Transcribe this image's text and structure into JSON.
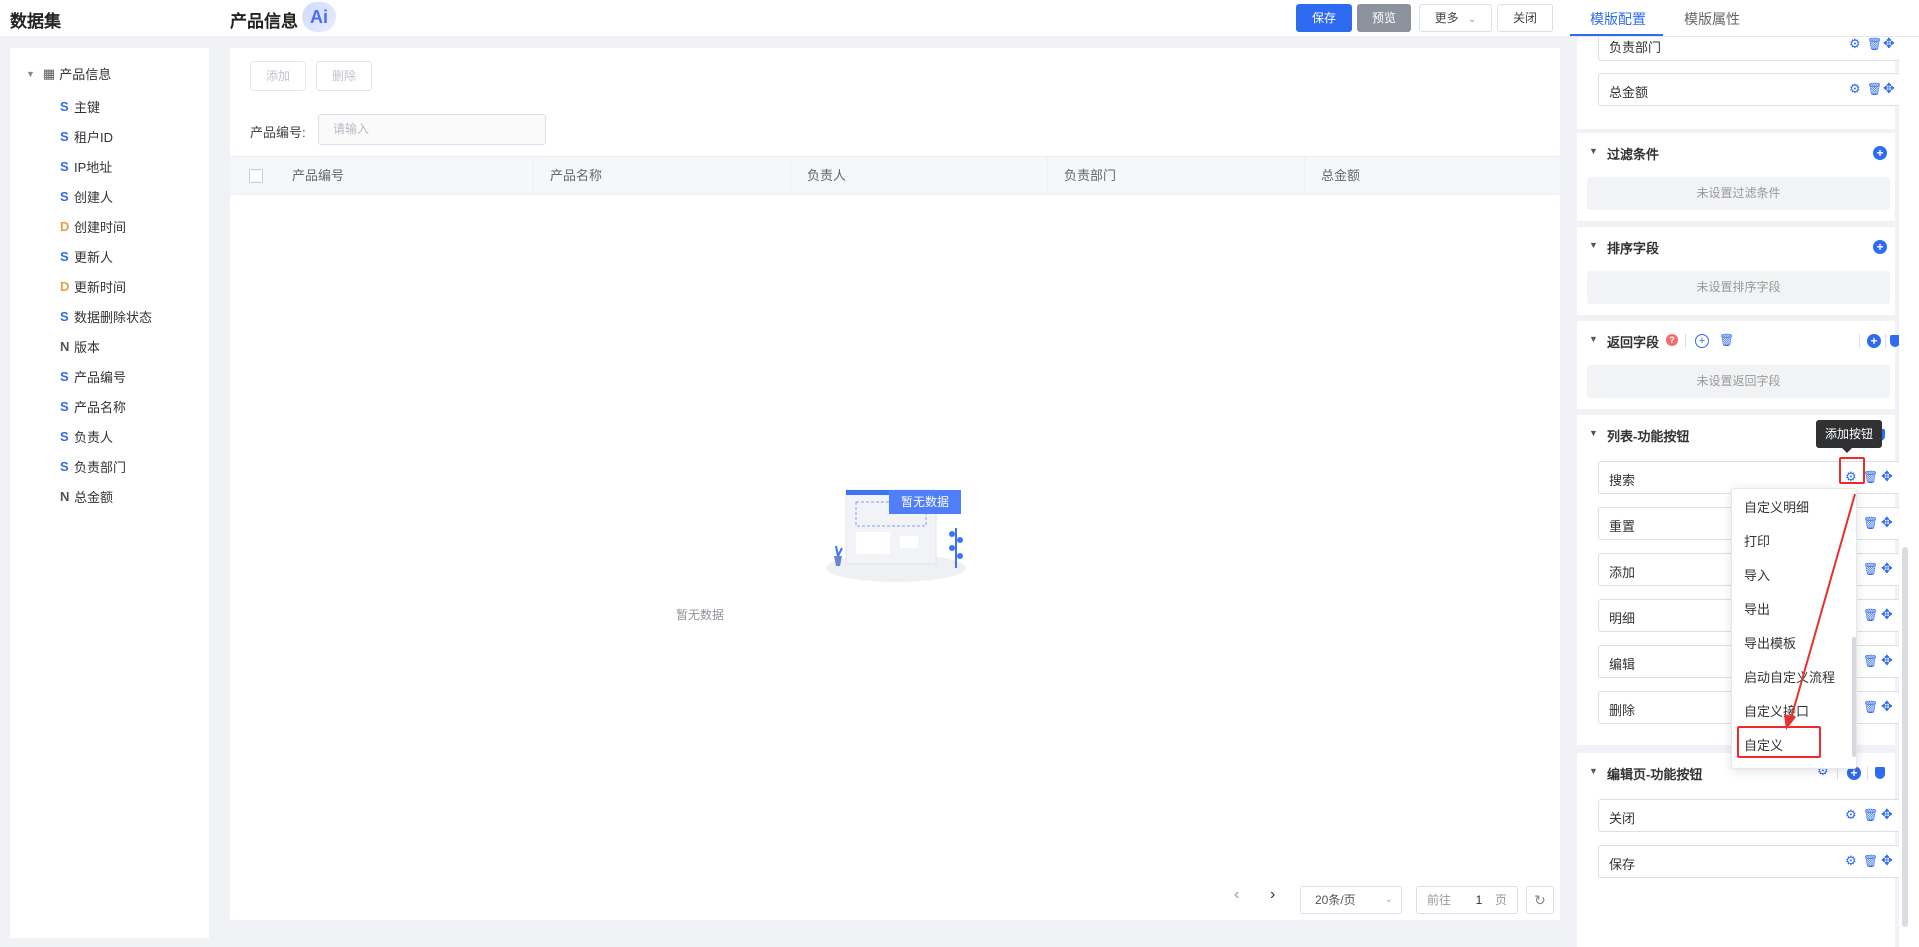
{
  "header": {
    "app_title": "数据集",
    "page_title": "产品信息",
    "ai_badge": "Ai",
    "save_label": "保存",
    "preview_label": "预览",
    "more_label": "更多",
    "close_label": "关闭"
  },
  "tree": {
    "root_label": "产品信息",
    "items": [
      {
        "type": "S",
        "label": "主键"
      },
      {
        "type": "S",
        "label": "租户ID"
      },
      {
        "type": "S",
        "label": "IP地址"
      },
      {
        "type": "S",
        "label": "创建人"
      },
      {
        "type": "D",
        "label": "创建时间"
      },
      {
        "type": "S",
        "label": "更新人"
      },
      {
        "type": "D",
        "label": "更新时间"
      },
      {
        "type": "S",
        "label": "数据删除状态"
      },
      {
        "type": "N",
        "label": "版本"
      },
      {
        "type": "S",
        "label": "产品编号"
      },
      {
        "type": "S",
        "label": "产品名称"
      },
      {
        "type": "S",
        "label": "负责人"
      },
      {
        "type": "S",
        "label": "负责部门"
      },
      {
        "type": "N",
        "label": "总金额"
      }
    ]
  },
  "main": {
    "add_label": "添加",
    "delete_label": "删除",
    "search_label": "产品编号:",
    "search_placeholder": "请输入",
    "columns": [
      "产品编号",
      "产品名称",
      "负责人",
      "负责部门",
      "总金额"
    ],
    "empty_badge": "暂无数据",
    "empty_text": "暂无数据",
    "page_size": "20条/页",
    "goto_prefix": "前往",
    "goto_page": "1",
    "goto_suffix": "页"
  },
  "right": {
    "tab_template_config": "模版配置",
    "tab_template_props": "模版属性",
    "top_fields": [
      "负责部门",
      "总金额"
    ],
    "filter_title": "过滤条件",
    "filter_empty": "未设置过滤条件",
    "sort_title": "排序字段",
    "sort_empty": "未设置排序字段",
    "return_title": "返回字段",
    "return_empty": "未设置返回字段",
    "list_buttons_title": "列表-功能按钮",
    "list_buttons": [
      "搜索",
      "重置",
      "添加",
      "明细",
      "编辑",
      "删除"
    ],
    "edit_buttons_title": "编辑页-功能按钮",
    "edit_buttons": [
      "关闭",
      "保存"
    ],
    "tooltip": "添加按钮"
  },
  "dropdown": {
    "items": [
      "自定义明细",
      "打印",
      "导入",
      "导出",
      "导出模板",
      "启动自定义流程",
      "自定义接口",
      "自定义"
    ]
  },
  "colors": {
    "primary": "#2f6bf0",
    "highlight": "#ee2a2a",
    "date_type": "#e6a23c"
  }
}
